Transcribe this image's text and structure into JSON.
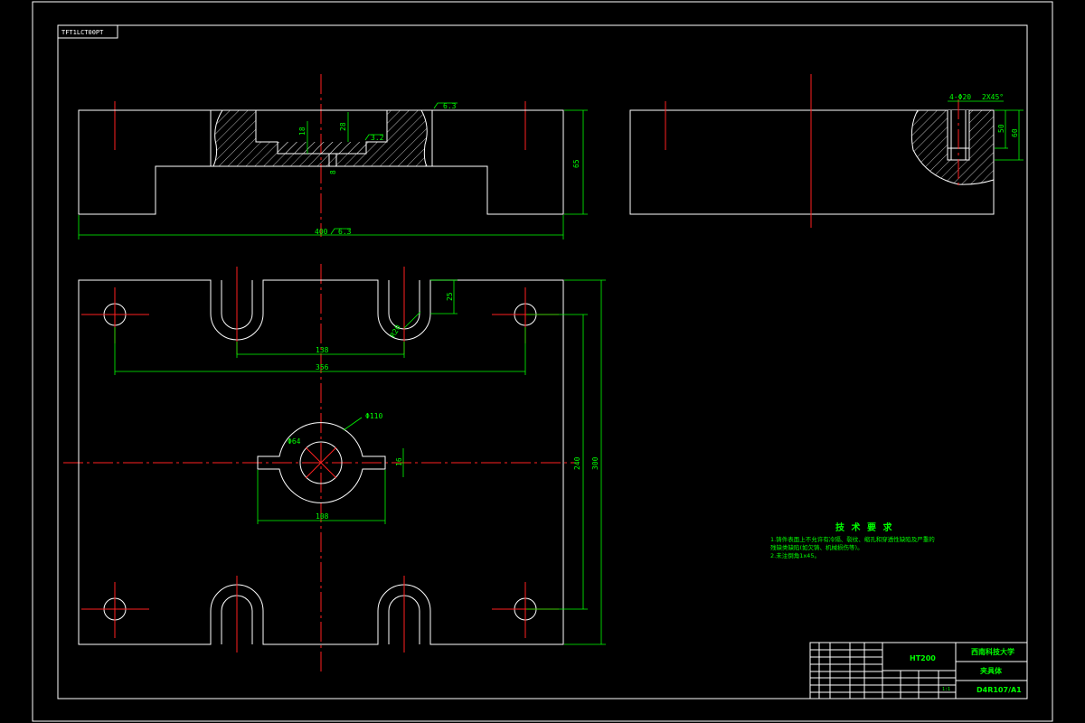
{
  "drawing_code": "TFT1LCT00PT",
  "dims": {
    "overall_length": "400",
    "height": "65",
    "slot_spacing": "138",
    "hole_spacing": "356",
    "slot_depth": "25",
    "center_width": "108",
    "plate_width_inner": "240",
    "plate_width": "300",
    "small_dia": "Φ64",
    "large_dia": "Φ110",
    "slot_radius": "R20",
    "step_a": "18",
    "step_b": "28",
    "hole_side": "4-Φ20",
    "chamfer": "2X45°",
    "side_a": "50",
    "side_b": "60",
    "key_w": "16",
    "small_h": "8"
  },
  "roughness": {
    "r1": "6.3",
    "r2": "3.2",
    "r3": "6.3"
  },
  "notes": {
    "heading": "技 术 要 求",
    "line1": "1.铸件表面上不允许有冷隔、裂纹、缩孔和穿透性缺陷及严重的",
    "line2": "残缺类缺陷(如欠铸、机械损伤等)。",
    "line3": "2.未注倒角1x45。"
  },
  "title_block": {
    "material": "HT200",
    "school": "西南科技大学",
    "part_name": "夹具体",
    "drawing_no": "D4R107/A1",
    "scale": "1:1"
  },
  "colors": {
    "outline": "#ffffff",
    "dimension": "#00ff00",
    "centerline": "#ff2020",
    "background": "#000000"
  }
}
